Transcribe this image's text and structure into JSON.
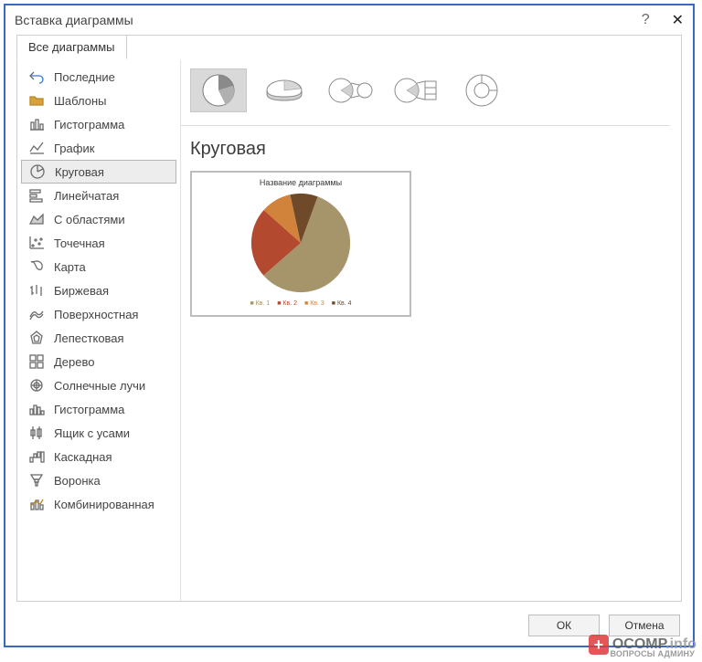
{
  "title": "Вставка диаграммы",
  "tab_all": "Все диаграммы",
  "sidebar": {
    "items": [
      {
        "label": "Последние",
        "icon": "undo"
      },
      {
        "label": "Шаблоны",
        "icon": "folder"
      },
      {
        "label": "Гистограмма",
        "icon": "columns"
      },
      {
        "label": "График",
        "icon": "line"
      },
      {
        "label": "Круговая",
        "icon": "pie",
        "selected": true
      },
      {
        "label": "Линейчатая",
        "icon": "bars-h"
      },
      {
        "label": "С областями",
        "icon": "area"
      },
      {
        "label": "Точечная",
        "icon": "scatter"
      },
      {
        "label": "Карта",
        "icon": "map"
      },
      {
        "label": "Биржевая",
        "icon": "stock"
      },
      {
        "label": "Поверхностная",
        "icon": "surface"
      },
      {
        "label": "Лепестковая",
        "icon": "radar"
      },
      {
        "label": "Дерево",
        "icon": "tree"
      },
      {
        "label": "Солнечные лучи",
        "icon": "sunburst"
      },
      {
        "label": "Гистограмма",
        "icon": "histogram"
      },
      {
        "label": "Ящик с усами",
        "icon": "boxplot"
      },
      {
        "label": "Каскадная",
        "icon": "waterfall"
      },
      {
        "label": "Воронка",
        "icon": "funnel"
      },
      {
        "label": "Комбинированная",
        "icon": "combo"
      }
    ]
  },
  "subtypes": [
    "pie",
    "pie-3d",
    "pie-of-pie",
    "bar-of-pie",
    "doughnut"
  ],
  "subtitle": "Круговая",
  "preview": {
    "title": "Название диаграммы",
    "legend": [
      "Кв. 1",
      "Кв. 2",
      "Кв. 3",
      "Кв. 4"
    ]
  },
  "chart_data": {
    "type": "pie",
    "title": "Название диаграммы",
    "categories": [
      "Кв. 1",
      "Кв. 2",
      "Кв. 3",
      "Кв. 4"
    ],
    "values": [
      58,
      23,
      10,
      9
    ],
    "colors": [
      "#a6946a",
      "#b34a30",
      "#d1833b",
      "#6e4a2b"
    ]
  },
  "buttons": {
    "ok": "ОК",
    "cancel": "Отмена"
  },
  "watermark": {
    "brand": "OCOMP",
    "suffix": ".info",
    "sub": "ВОПРОСЫ АДМИНУ"
  }
}
